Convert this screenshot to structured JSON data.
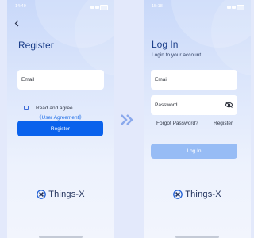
{
  "colors": {
    "accent": "#0a62ec",
    "accent_disabled": "#97bcf5",
    "title": "#1c3f8a",
    "link": "#1f6ee8",
    "background": "#e3e9fb"
  },
  "register": {
    "status_time": "14:49",
    "back_icon": "back-arrow-icon",
    "title": "Register",
    "email_placeholder": "Email",
    "agree_text": "Read and agree",
    "agreement_link": "《User Agreement》",
    "button_label": "Register",
    "logo_text": "Things-X"
  },
  "transition_icon": "double-chevron-right-icon",
  "login": {
    "status_time": "15:18",
    "title": "Log In",
    "subtitle": "Login to your account",
    "email_placeholder": "Email",
    "password_placeholder": "Password",
    "password_toggle_icon": "eye-off-icon",
    "forgot_password": "Forgot Password?",
    "register_link": "Register",
    "button_label": "Log In",
    "logo_text": "Things-X"
  }
}
